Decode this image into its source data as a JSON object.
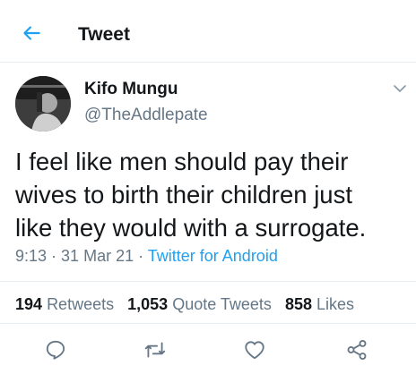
{
  "header": {
    "title": "Tweet"
  },
  "author": {
    "name": "Kifo Mungu",
    "handle": "@TheAddlepate"
  },
  "tweet": {
    "lines": [
      "I feel like men should pay their",
      "wives to birth their children just",
      "like they would with a surrogate."
    ],
    "time": "9:13",
    "separator1": " · ",
    "date": "31 Mar 21",
    "separator2": " · ",
    "source": "Twitter for Android"
  },
  "stats": {
    "retweets_count": "194",
    "retweets_label": "Retweets",
    "quotes_count": "1,053",
    "quotes_label": "Quote Tweets",
    "likes_count": "858",
    "likes_label": "Likes"
  },
  "colors": {
    "accent": "#1da1f2",
    "secondary": "#657786",
    "text": "#14171a",
    "divider": "#e6ecf0"
  },
  "icons": [
    "back-arrow-icon",
    "chevron-down-icon",
    "reply-icon",
    "retweet-icon",
    "like-icon",
    "share-icon"
  ]
}
